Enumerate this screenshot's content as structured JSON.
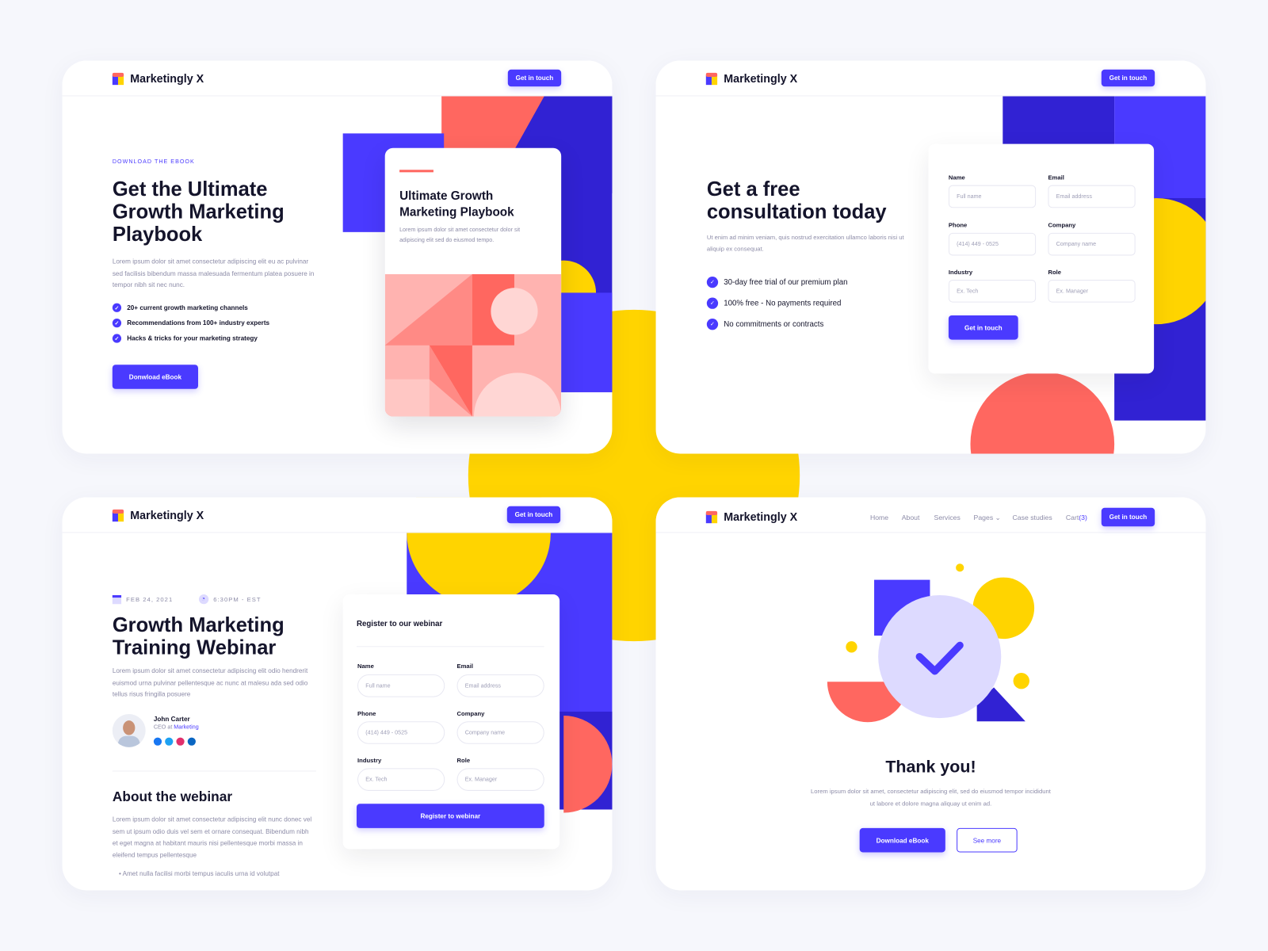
{
  "brand": {
    "name": "Marketingly X",
    "cta": "Get in touch"
  },
  "colors": {
    "primary": "#4a3aff",
    "yellow": "#ffd400",
    "coral": "#ff6760",
    "dark_blue": "#3122d3",
    "lavender": "#dddaff"
  },
  "ebook": {
    "eyebrow": "DOWNLOAD THE EBOOK",
    "title": "Get the Ultimate Growth Marketing Playbook",
    "description": "Lorem ipsum dolor sit amet consectetur adipiscing elit eu ac pulvinar sed facilisis bibendum massa malesuada fermentum platea posuere in tempor nibh sit nec nunc.",
    "features": [
      "20+ current growth marketing channels",
      "Recommendations from 100+ industry experts",
      "Hacks & tricks for your marketing strategy"
    ],
    "button": "Donwload eBook",
    "book": {
      "title": "Ultimate Growth Marketing Playbook",
      "description": "Lorem ipsum dolor sit amet consectetur dolor sit adipiscing elit sed do eiusmod tempo."
    }
  },
  "consultation": {
    "title": "Get a free consultation today",
    "description": "Ut enim ad minim veniam, quis nostrud exercitation ullamco laboris nisi ut aliquip ex consequat.",
    "features": [
      "30-day free trial of our premium plan",
      "100% free - No payments required",
      "No commitments or contracts"
    ],
    "form": {
      "fields": [
        {
          "label": "Name",
          "placeholder": "Full name"
        },
        {
          "label": "Email",
          "placeholder": "Email address"
        },
        {
          "label": "Phone",
          "placeholder": "(414) 449 - 0525"
        },
        {
          "label": "Company",
          "placeholder": "Company name"
        },
        {
          "label": "Industry",
          "placeholder": "Ex. Tech"
        },
        {
          "label": "Role",
          "placeholder": "Ex. Manager"
        }
      ],
      "submit": "Get in touch"
    }
  },
  "webinar": {
    "date": "FEB 24, 2021",
    "time": "6:30PM - EST",
    "title": "Growth Marketing Training Webinar",
    "description": "Lorem ipsum dolor sit amet consectetur adipiscing elit odio hendrerit euismod urna pulvinar pellentesque ac nunc at malesu ada sed odio tellus risus fringilla posuere",
    "author": {
      "name": "John Carter",
      "role": "CEO",
      "at": "at",
      "company": "Marketing"
    },
    "about_title": "About the webinar",
    "about_text": "Lorem ipsum dolor sit amet consectetur adipiscing elit nunc donec vel sem ut ipsum odio duis vel sem et ornare consequat. Bibendum nibh et eget magna at habitant mauris nisi pellentesque morbi massa in eleifend tempus pellentesque",
    "bullets": [
      "Amet nulla facilisi morbi tempus iaculis urna id volutpat"
    ],
    "form": {
      "title": "Register to our webinar",
      "fields": [
        {
          "label": "Name",
          "placeholder": "Full name"
        },
        {
          "label": "Email",
          "placeholder": "Email address"
        },
        {
          "label": "Phone",
          "placeholder": "(414) 449 - 0525"
        },
        {
          "label": "Company",
          "placeholder": "Company name"
        },
        {
          "label": "Industry",
          "placeholder": "Ex. Tech"
        },
        {
          "label": "Role",
          "placeholder": "Ex. Manager"
        }
      ],
      "submit": "Register to webinar"
    }
  },
  "thankyou": {
    "nav": [
      "Home",
      "About",
      "Services",
      "Pages",
      "Case studies"
    ],
    "cart_label": "Cart",
    "cart_count": "(3)",
    "title": "Thank you!",
    "description": "Lorem ipsum dolor sit amet, consectetur adipiscing elit, sed do eiusmod tempor incididunt ut labore et dolore magna aliquay ut enim ad.",
    "primary_button": "Download eBook",
    "secondary_button": "See more"
  }
}
